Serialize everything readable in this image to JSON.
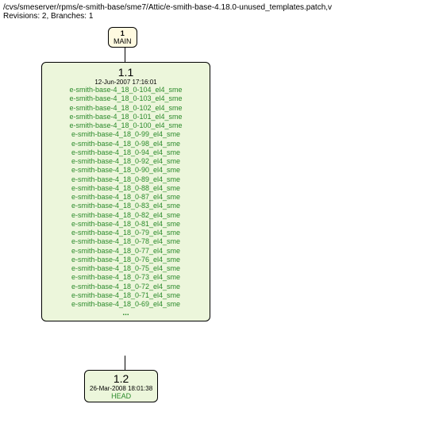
{
  "header": {
    "path": "/cvs/smeserver/rpms/e-smith-base/sme7/Attic/e-smith-base-4.18.0-unused_templates.patch,v",
    "meta": "Revisions: 2, Branches: 1"
  },
  "branch_node": {
    "number": "1",
    "name": "MAIN"
  },
  "rev_1_1": {
    "label": "1.1",
    "date": "12-Jun-2007 17:16:01",
    "tags": [
      "e-smith-base-4_18_0-104_el4_sme",
      "e-smith-base-4_18_0-103_el4_sme",
      "e-smith-base-4_18_0-102_el4_sme",
      "e-smith-base-4_18_0-101_el4_sme",
      "e-smith-base-4_18_0-100_el4_sme",
      "e-smith-base-4_18_0-99_el4_sme",
      "e-smith-base-4_18_0-98_el4_sme",
      "e-smith-base-4_18_0-94_el4_sme",
      "e-smith-base-4_18_0-92_el4_sme",
      "e-smith-base-4_18_0-90_el4_sme",
      "e-smith-base-4_18_0-89_el4_sme",
      "e-smith-base-4_18_0-88_el4_sme",
      "e-smith-base-4_18_0-87_el4_sme",
      "e-smith-base-4_18_0-83_el4_sme",
      "e-smith-base-4_18_0-82_el4_sme",
      "e-smith-base-4_18_0-81_el4_sme",
      "e-smith-base-4_18_0-79_el4_sme",
      "e-smith-base-4_18_0-78_el4_sme",
      "e-smith-base-4_18_0-77_el4_sme",
      "e-smith-base-4_18_0-76_el4_sme",
      "e-smith-base-4_18_0-75_el4_sme",
      "e-smith-base-4_18_0-73_el4_sme",
      "e-smith-base-4_18_0-72_el4_sme",
      "e-smith-base-4_18_0-71_el4_sme",
      "e-smith-base-4_18_0-69_el4_sme"
    ],
    "ellipsis": "..."
  },
  "rev_1_2": {
    "label": "1.2",
    "date": "26-Mar-2008 18:01:38",
    "head": "HEAD"
  }
}
